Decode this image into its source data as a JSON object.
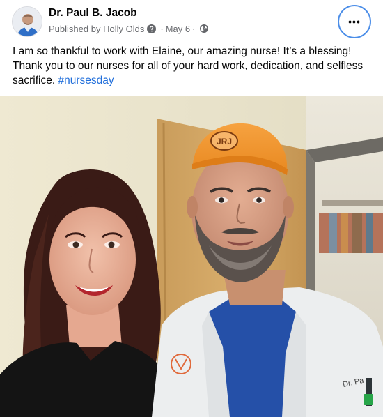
{
  "post": {
    "author_name": "Dr. Paul B. Jacob",
    "published_prefix": "Published by",
    "publisher_name": "Holly Olds",
    "separator": "·",
    "date": "May 6",
    "caption_text": "I am so thankful to work with Elaine, our amazing nurse! It’s a blessing! Thank you to our nurses for all of your hard work, dedication, and selfless sacrifice. ",
    "hashtag": "#nursesday",
    "cap_logo_text": "JRJ",
    "coat_name_text": "Dr. Pa",
    "more_button_glyph": "•••"
  },
  "icons": {
    "question": "question-circle-icon",
    "globe": "globe-icon",
    "more": "more-options-icon"
  },
  "colors": {
    "hashtag_blue": "#216fdb",
    "meta_gray": "#65676b",
    "focus_ring": "#4c8ee8"
  }
}
